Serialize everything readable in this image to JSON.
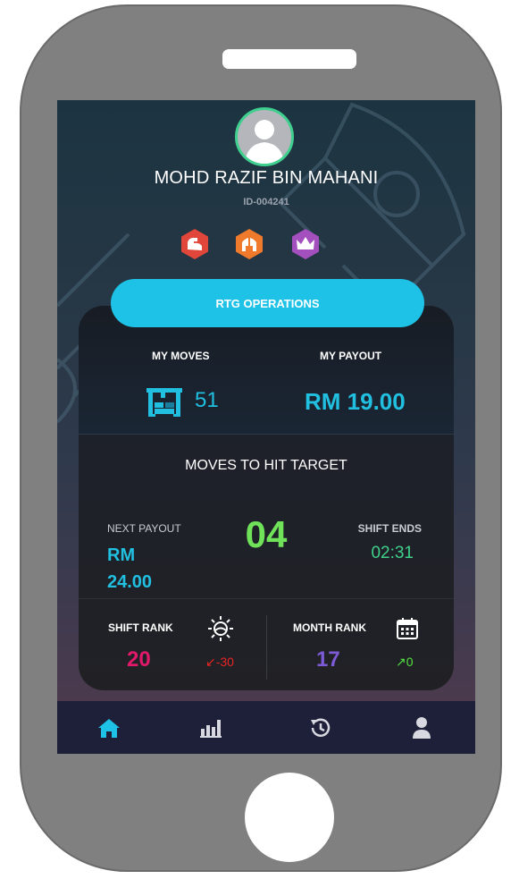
{
  "profile": {
    "name": "MOHD RAZIF BIN MAHANI",
    "id": "ID-004241",
    "badges": [
      "flexed-arm-badge",
      "helmet-badge",
      "crown-badge"
    ]
  },
  "department_button": "RTG OPERATIONS",
  "stats": {
    "my_moves_label": "MY MOVES",
    "my_moves_value": "51",
    "my_payout_label": "MY PAYOUT",
    "my_payout_value": "RM 19.00"
  },
  "target": {
    "title": "MOVES TO HIT TARGET",
    "next_payout_label": "NEXT PAYOUT",
    "next_payout_currency": "RM",
    "next_payout_amount": "24.00",
    "moves_remaining": "04",
    "shift_ends_label": "SHIFT ENDS",
    "shift_ends_time": "02:31"
  },
  "ranks": {
    "shift_rank_label": "SHIFT RANK",
    "shift_rank_value": "20",
    "shift_rank_change": "-30",
    "month_rank_label": "MONTH RANK",
    "month_rank_value": "17",
    "month_rank_change": "0"
  },
  "nav": [
    "home-icon",
    "bar-chart-icon",
    "history-icon",
    "profile-icon"
  ],
  "colors": {
    "accent_cyan": "#1ec2e6",
    "green": "#6fe25a",
    "shift_rank": "#e0196b",
    "month_rank": "#7e5bd6",
    "negative": "#e82525",
    "positive": "#53e040",
    "nav_active": "#1ec2e6"
  }
}
